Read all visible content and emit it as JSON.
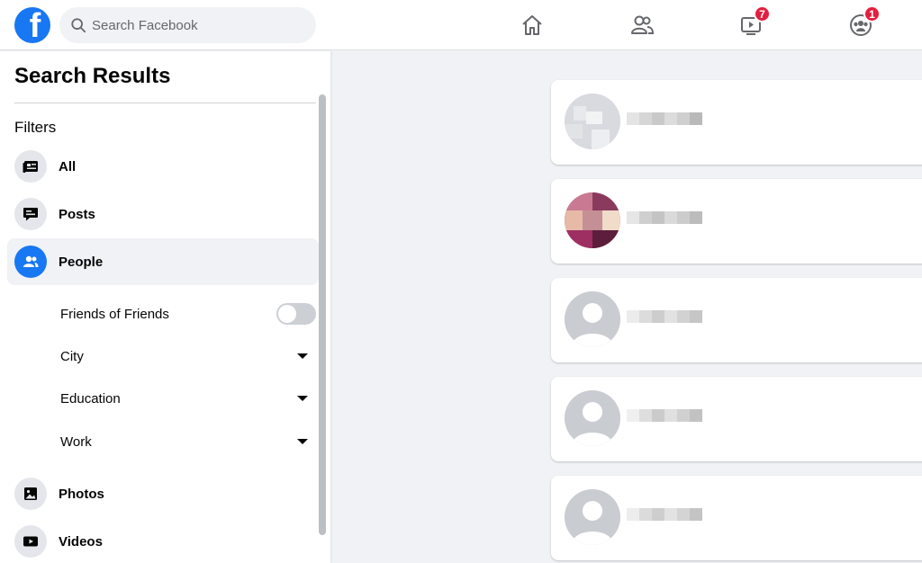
{
  "topbar": {
    "logo_letter": "f",
    "search_placeholder": "Search Facebook",
    "nav": [
      {
        "name": "home",
        "icon": "home-icon"
      },
      {
        "name": "friends",
        "icon": "friends-icon"
      },
      {
        "name": "watch",
        "icon": "watch-icon",
        "badge": "7"
      },
      {
        "name": "groups",
        "icon": "groups-icon",
        "badge": "1"
      }
    ]
  },
  "sidebar": {
    "title": "Search Results",
    "filters_label": "Filters",
    "items": [
      {
        "label": "All",
        "icon": "feed-icon",
        "active": false
      },
      {
        "label": "Posts",
        "icon": "posts-icon",
        "active": false
      },
      {
        "label": "People",
        "icon": "people-icon",
        "active": true
      },
      {
        "label": "Photos",
        "icon": "photos-icon",
        "active": false
      },
      {
        "label": "Videos",
        "icon": "videos-icon",
        "active": false
      }
    ],
    "people_filters": [
      {
        "label": "Friends of Friends",
        "control": "toggle",
        "on": false
      },
      {
        "label": "City",
        "control": "dropdown"
      },
      {
        "label": "Education",
        "control": "dropdown"
      },
      {
        "label": "Work",
        "control": "dropdown"
      }
    ]
  },
  "results": [
    {
      "avatar": "blurred-photo",
      "name": "(pixelated)"
    },
    {
      "avatar": "blurred-photo",
      "name": "(pixelated)"
    },
    {
      "avatar": "default-avatar",
      "name": "(pixelated)"
    },
    {
      "avatar": "default-avatar",
      "name": "(pixelated)"
    },
    {
      "avatar": "default-avatar",
      "name": "(pixelated)"
    }
  ],
  "colors": {
    "brand": "#1877f2",
    "badge": "#e41e3f",
    "background": "#f0f2f5",
    "text": "#050505",
    "secondary_text": "#65676b"
  }
}
